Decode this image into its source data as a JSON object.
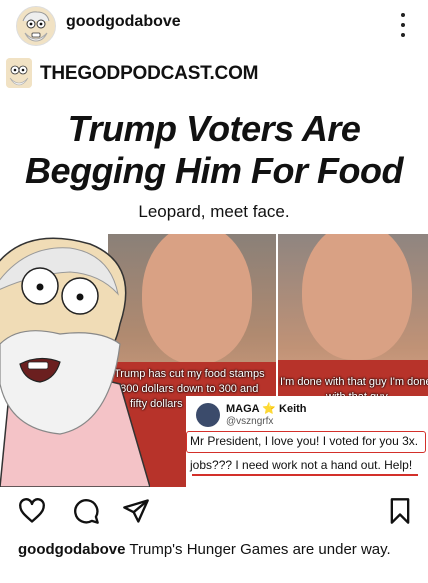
{
  "header": {
    "username": "goodgodabove",
    "avatar_icon": "cartoon-god-avatar-icon",
    "more_icon": "more-vertical-icon"
  },
  "post": {
    "brand": "THEGODPODCAST.COM",
    "headline_line1": "Trump Voters Are",
    "headline_line2": "Begging Him For Food",
    "subhead": "Leopard, meet face.",
    "video_caption_left_line1": "Trump has cut my food stamps",
    "video_caption_left_line2": "2800 dollars down to 300 and",
    "video_caption_left_line3": "fifty dollars",
    "video_caption_right_line1": "I'm done with that guy I'm done",
    "video_caption_right_line2": "with that guy",
    "tweet": {
      "name": "MAGA ⭐ Keith",
      "handle": "@vszngrfx",
      "line1": "Mr President, I love you! I voted for you 3x.",
      "line2": "jobs??? I need work not  a hand out. Help!"
    }
  },
  "actions": {
    "like_icon": "heart-icon",
    "comment_icon": "comment-icon",
    "share_icon": "send-icon",
    "save_icon": "bookmark-icon"
  },
  "caption": {
    "username": "goodgodabove",
    "text": " Trump's Hunger Games are under way."
  },
  "colors": {
    "highlight_red": "#d3302a",
    "shirt_red": "#b7332a"
  }
}
